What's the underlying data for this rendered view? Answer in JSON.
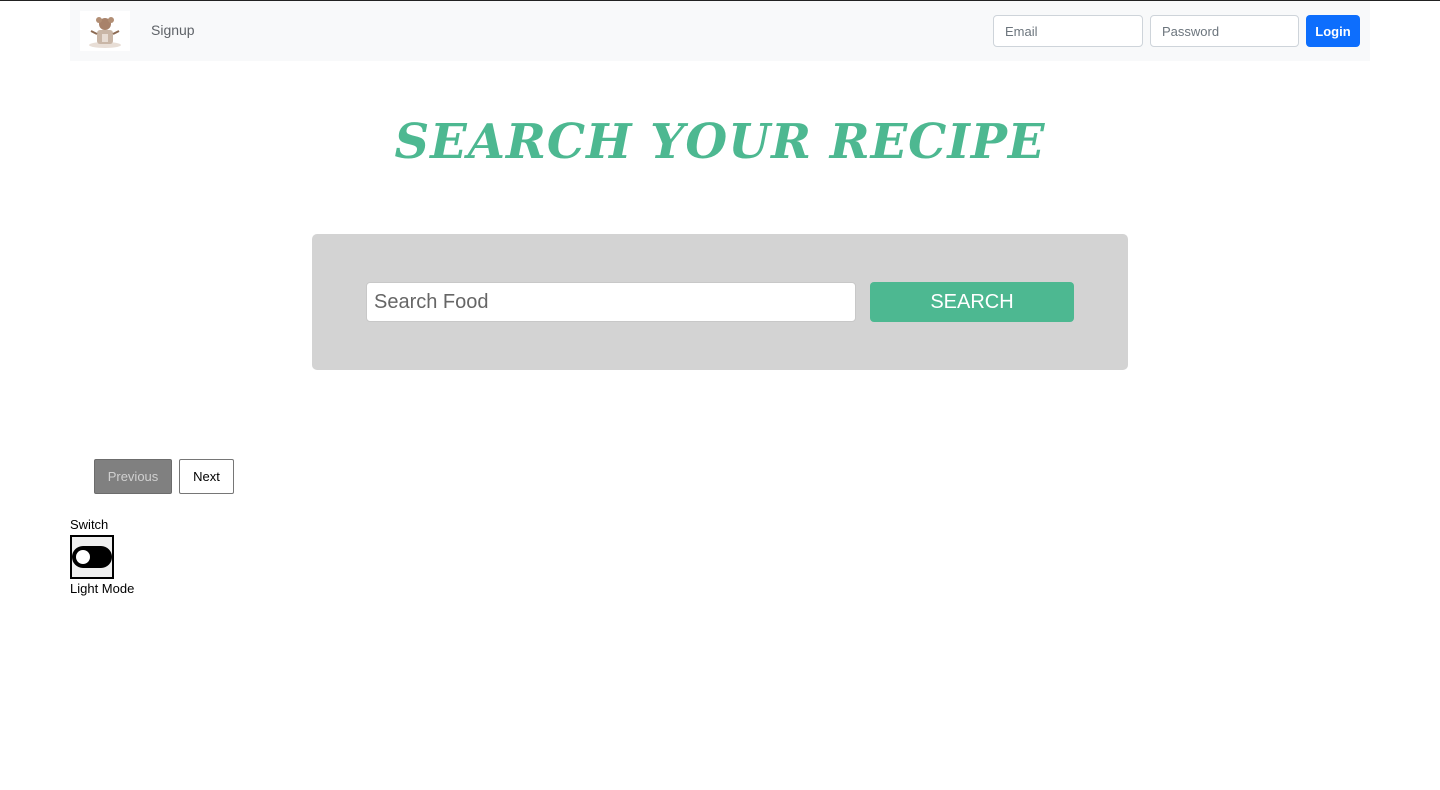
{
  "navbar": {
    "logo_icon": "chef-logo-icon",
    "signup_label": "Signup",
    "email_placeholder": "Email",
    "password_placeholder": "Password",
    "login_label": "Login"
  },
  "hero": {
    "title": "SEARCH YOUR RECIPE"
  },
  "search": {
    "placeholder": "Search Food",
    "button_label": "SEARCH"
  },
  "pagination": {
    "previous_label": "Previous",
    "next_label": "Next"
  },
  "theme": {
    "switch_label": "Switch",
    "mode_label": "Light Mode",
    "toggle_on": false
  },
  "colors": {
    "accent": "#4db891",
    "login": "#0d6efd",
    "panel": "#d3d3d3"
  }
}
